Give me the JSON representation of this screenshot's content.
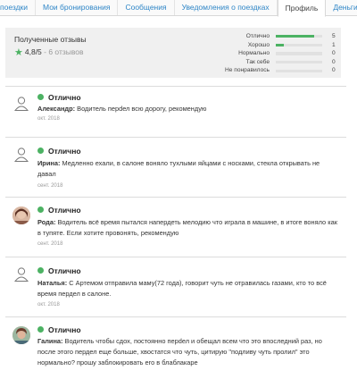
{
  "tabs": [
    {
      "label": "поездки"
    },
    {
      "label": "Мои бронирования"
    },
    {
      "label": "Сообщения"
    },
    {
      "label": "Уведомления о поездках"
    },
    {
      "label": "Профиль"
    },
    {
      "label": "Деньги",
      "dropdown": true
    }
  ],
  "summary": {
    "title": "Полученные отзывы",
    "rating": "4,8/5",
    "count_text": "- 6 отзывов",
    "breakdown": [
      {
        "label": "Отлично",
        "count": "5",
        "share": 0.83
      },
      {
        "label": "Хорошо",
        "count": "1",
        "share": 0.17
      },
      {
        "label": "Нормально",
        "count": "0",
        "share": 0
      },
      {
        "label": "Так себе",
        "count": "0",
        "share": 0
      },
      {
        "label": "Не понравилось",
        "count": "0",
        "share": 0
      }
    ]
  },
  "reviews": [
    {
      "avatar": "default",
      "rating_label": "Отлично",
      "author": "Александр:",
      "text": "Водитель перdел всю дорогу, рекомендую",
      "date": "окт. 2018"
    },
    {
      "avatar": "default",
      "rating_label": "Отлично",
      "author": "Ирина:",
      "text": "Медленно ехали, в салоне воняло тухлыми яйцами с носками, стекла открывать не давал",
      "date": "сент. 2018"
    },
    {
      "avatar": "photo",
      "rating_label": "Отлично",
      "author": "Рода:",
      "text": "Водитель всё время пытался напердеть мелодию что играла в машине, в итоге воняло как в тупяте. Если хотите провонять, рекомендую",
      "date": "сент. 2018"
    },
    {
      "avatar": "default",
      "rating_label": "Отлично",
      "author": "Наталья:",
      "text": "С Артемом отправила маму(72 года), говорит чуть не отравилась газами, кто то всё время пердел в салоне.",
      "date": "окт. 2018"
    },
    {
      "avatar": "photo",
      "rating_label": "Отлично",
      "author": "Галина:",
      "text": "Водитель чтобы сдох, постоянно перdел и обещал всем что это впоследний раз, но после этого пердел еще больше, хвостатся что чуть, цитирую \"подливу чуть пролил\" это нормально? прошу заблокировать его в блаблакаре",
      "date": ""
    }
  ],
  "colors": {
    "accent": "#4cb263",
    "link": "#2f86c7"
  }
}
